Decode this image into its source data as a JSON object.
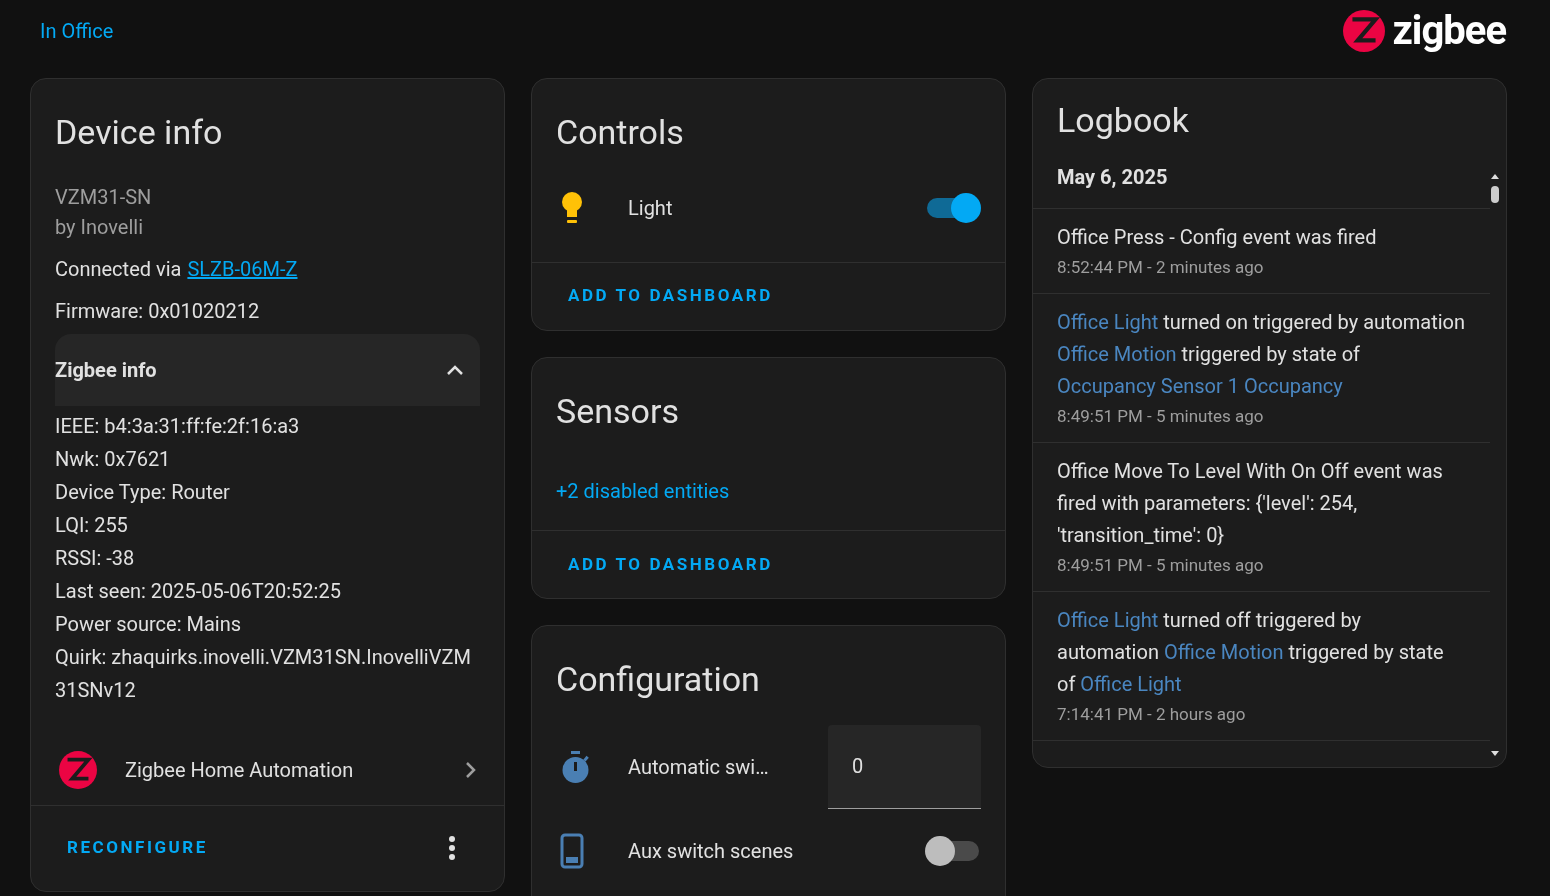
{
  "header": {
    "breadcrumb": "In Office",
    "logo_text": "zigbee"
  },
  "device_info": {
    "title": "Device info",
    "model": "VZM31-SN",
    "manufacturer": "by Inovelli",
    "connected_label": "Connected via",
    "connected_link": "SLZB-06M-Z",
    "firmware": "Firmware: 0x01020212",
    "zigbee_info": {
      "title": "Zigbee info",
      "expanded": true,
      "lines": [
        "IEEE: b4:3a:31:ff:fe:2f:16:a3",
        "Nwk: 0x7621",
        "Device Type: Router",
        "LQI: 255",
        "RSSI: -38",
        "Last seen: 2025-05-06T20:52:25",
        "Power source: Mains",
        "Quirk: zhaquirks.inovelli.VZM31SN.InovelliVZM31SNv12"
      ]
    },
    "integration": "Zigbee Home Automation",
    "action": "RECONFIGURE"
  },
  "controls": {
    "title": "Controls",
    "rows": [
      {
        "kind": "switch",
        "label": "Light",
        "on": true
      }
    ],
    "action": "ADD TO DASHBOARD"
  },
  "sensors": {
    "title": "Sensors",
    "disabled_link": "+2 disabled entities",
    "action": "ADD TO DASHBOARD"
  },
  "configuration": {
    "title": "Configuration",
    "rows": [
      {
        "kind": "number",
        "label": "Automatic swi…",
        "value": "0"
      },
      {
        "kind": "switch",
        "label": "Aux switch scenes",
        "on": false
      }
    ]
  },
  "logbook": {
    "title": "Logbook",
    "date": "May 6, 2025",
    "entries": [
      {
        "message": [
          {
            "text": "Office Press - Config event was fired",
            "link": false
          }
        ],
        "time": "8:52:44 PM - 2 minutes ago"
      },
      {
        "message": [
          {
            "text": "Office Light",
            "link": true
          },
          {
            "text": " turned on triggered by automation ",
            "link": false
          },
          {
            "text": "Office Motion",
            "link": true
          },
          {
            "text": " triggered by state of ",
            "link": false
          },
          {
            "text": "Occupancy Sensor 1 Occupancy",
            "link": true
          }
        ],
        "time": "8:49:51 PM - 5 minutes ago"
      },
      {
        "message": [
          {
            "text": "Office Move To Level With On Off event was fired with parameters: {'level': 254, 'transition_time': 0}",
            "link": false
          }
        ],
        "time": "8:49:51 PM - 5 minutes ago"
      },
      {
        "message": [
          {
            "text": "Office Light",
            "link": true
          },
          {
            "text": " turned off triggered by automation ",
            "link": false
          },
          {
            "text": "Office Motion",
            "link": true
          },
          {
            "text": " triggered by state of ",
            "link": false
          },
          {
            "text": "Office Light",
            "link": true
          }
        ],
        "time": "7:14:41 PM - 2 hours ago"
      }
    ]
  }
}
